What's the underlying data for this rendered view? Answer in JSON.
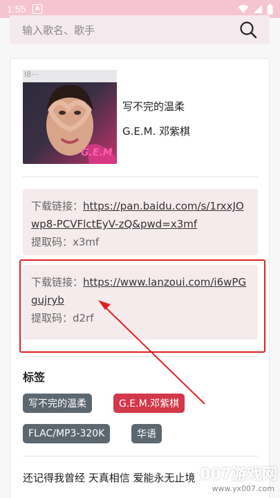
{
  "status_bar": {
    "time": "1:55",
    "badge": "A"
  },
  "search": {
    "placeholder": "输入歌名、歌手"
  },
  "song": {
    "cover_text": "I8⋯",
    "cover_logo": "G.E.M",
    "title": "写不完的温柔",
    "artist": "G.E.M. 邓紫棋"
  },
  "downloads": [
    {
      "label": "下载链接：",
      "url": "https://pan.baidu.com/s/1rxxJOwp8-PCVFlctEyV-zQ&pwd=x3mf",
      "code_label": "提取码：",
      "code": "x3mf"
    },
    {
      "label": "下载链接：",
      "url": "https://www.lanzoui.com/i6wPGgujryb",
      "code_label": "提取码：",
      "code": "d2rf"
    }
  ],
  "tags": {
    "title": "标签",
    "items": [
      "写不完的温柔",
      "G.E.M.邓紫棋",
      "FLAC/MP3-320K",
      "华语"
    ]
  },
  "lyric": "还记得我曾经 天真相信 爱能永无止境",
  "watermark": {
    "brand": "007游戏网",
    "url": "www.yx007.com"
  },
  "colors": {
    "status_bar": "#f6c4d0",
    "tag_gray": "#5c6770",
    "tag_red": "#d23849",
    "highlight": "#e02020"
  }
}
